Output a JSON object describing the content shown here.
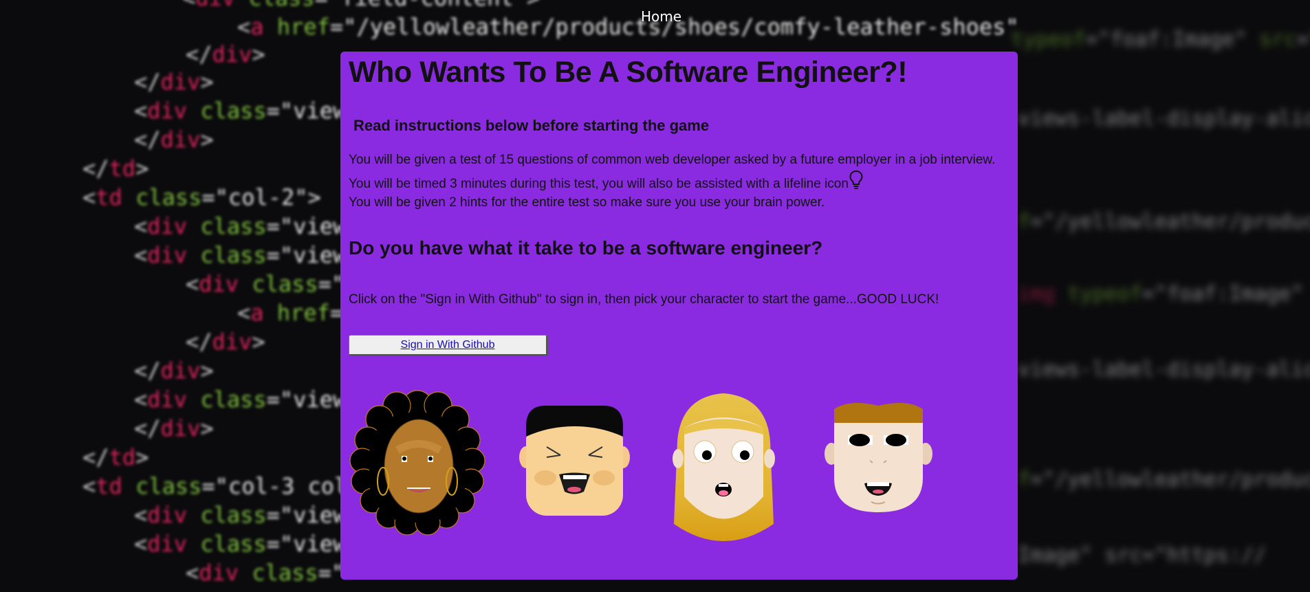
{
  "nav": {
    "home_label": "Home"
  },
  "intro": {
    "title": "Who Wants To Be A Software Engineer?!",
    "subtitle": "Read instructions below before starting the game",
    "line1": "You will be given a test of 15 questions of common web developer asked by a future employer in a job interview.",
    "line2": "You will be timed 3 minutes during this test, you will also be assisted with a lifeline icon",
    "line3": "You will be given 2 hints for the entire test so make sure you use your brain power.",
    "lifeline_icon": "lightbulb-icon",
    "question": "Do you have what it take to be a software engineer?",
    "instruction": "Click on the \"Sign in With Github\" to sign in, then pick your character to start the game...GOOD LUCK!"
  },
  "auth": {
    "github_label": "Sign in With Github"
  },
  "characters": [
    {
      "name": "curly-hair-woman-avatar"
    },
    {
      "name": "black-hair-man-avatar"
    },
    {
      "name": "blonde-woman-avatar"
    },
    {
      "name": "ginger-man-avatar"
    }
  ],
  "background_code": [
    "<div class=\"field-content\">",
    "<a href=\"/yellowleather/products/shoes/comfy-leather-shoes\"",
    "</div>",
    "</div>",
    "<div class=\"view",
    "</div>",
    "</td>",
    "<td class=\"col-2\">",
    "<div class=\"view",
    "<div class=\"view",
    "<div class=\"",
    "<a href=",
    "</div>",
    "</div>",
    "<div class=\"view",
    "</div>",
    "</td>",
    "<td class=\"col-3 col",
    "<div class=\"view",
    "<div class=\"view",
    "<div class=\"",
    "<a href=\"/yellowleather/products"
  ],
  "colors": {
    "panel": "#8a2be2",
    "background": "#0b0b0d",
    "code_tag": "#e0245e",
    "code_attr": "#7fbf3f"
  }
}
